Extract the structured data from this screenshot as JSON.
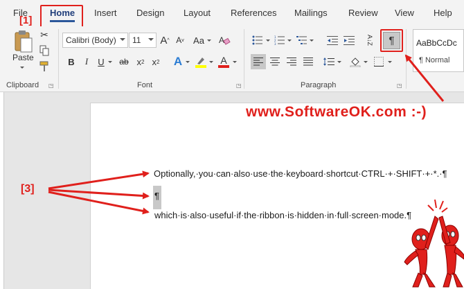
{
  "tabs": [
    {
      "label": "File"
    },
    {
      "label": "Home"
    },
    {
      "label": "Insert"
    },
    {
      "label": "Design"
    },
    {
      "label": "Layout"
    },
    {
      "label": "References"
    },
    {
      "label": "Mailings"
    },
    {
      "label": "Review"
    },
    {
      "label": "View"
    },
    {
      "label": "Help"
    }
  ],
  "clipboard": {
    "paste_label": "Paste",
    "group_label": "Clipboard"
  },
  "font": {
    "name": "Calibri (Body)",
    "size": "11",
    "grow": "A",
    "shrink": "A",
    "change_case": "Aa",
    "bold": "B",
    "italic": "I",
    "underline": "U",
    "strikethrough": "ab",
    "subscript": "x",
    "superscript": "x",
    "effects": "A",
    "highlight": "ab",
    "color": "A",
    "group_label": "Font"
  },
  "paragraph": {
    "sort": "A↓Z",
    "show_marks": "¶",
    "group_label": "Paragraph"
  },
  "styles": {
    "preview": "AaBbCcDc",
    "normal": "¶ Normal"
  },
  "document": {
    "lines": [
      "Optionally,·you·can·also·use·the·keyboard·shortcut·CTRL·+·SHIFT·+·*.·¶",
      "¶",
      "which·is·also·useful·if·the·ribbon·is·hidden·in·full·screen·mode.¶"
    ]
  },
  "annotations": {
    "label1": "[1]",
    "label3": "[3]",
    "watermark": "www.SoftwareOK.com :-)"
  },
  "colors": {
    "accent": "#2b579a",
    "annotation": "#e0201c",
    "highlight": "#ffff00",
    "font_color": "#e0201c"
  }
}
